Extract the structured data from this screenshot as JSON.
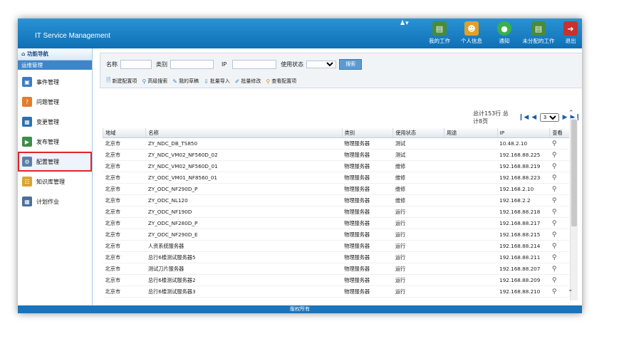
{
  "header": {
    "title": "IT Service Management",
    "nav": [
      {
        "label": "我的工作",
        "icon": "briefcase-icon"
      },
      {
        "label": "个人信息",
        "icon": "user-info-icon"
      },
      {
        "label": "通知",
        "icon": "notification-icon"
      },
      {
        "label": "未分配的工作",
        "icon": "unassigned-icon"
      },
      {
        "label": "退出",
        "icon": "exit-icon"
      }
    ]
  },
  "sidebar": {
    "heading": "功能导航",
    "group": "运维管理",
    "items": [
      {
        "label": "事件管理",
        "icon": "event-icon"
      },
      {
        "label": "问题管理",
        "icon": "problem-icon"
      },
      {
        "label": "变更管理",
        "icon": "change-icon"
      },
      {
        "label": "发布管理",
        "icon": "release-icon"
      },
      {
        "label": "配置管理",
        "icon": "config-icon"
      },
      {
        "label": "知识库管理",
        "icon": "knowledge-icon"
      },
      {
        "label": "计划作业",
        "icon": "calendar-icon"
      }
    ]
  },
  "search": {
    "name_label": "名称",
    "type_label": "类别",
    "ip_label": "IP",
    "status_label": "使用状态",
    "button": "搜索"
  },
  "toolbar": [
    {
      "label": "新建配置项",
      "icon": "new-doc-icon"
    },
    {
      "label": "高级搜索",
      "icon": "advanced-search-icon"
    },
    {
      "label": "我的草稿",
      "icon": "draft-icon"
    },
    {
      "label": "批量导入",
      "icon": "import-icon"
    },
    {
      "label": "批量修改",
      "icon": "batch-edit-icon"
    },
    {
      "label": "查看配置项",
      "icon": "view-config-icon"
    }
  ],
  "pager": {
    "summary": "总计153行 总计8页",
    "current_page": "3"
  },
  "table": {
    "columns": [
      "地域",
      "名称",
      "类别",
      "使用状态",
      "用途",
      "IP",
      "查看"
    ],
    "rows": [
      [
        "北京市",
        "ZY_NDC_DB_TS850",
        "物理服务器",
        "测试",
        "",
        "10.48.2.10"
      ],
      [
        "北京市",
        "ZY_NDC_VM02_NF560D_02",
        "物理服务器",
        "测试",
        "",
        "192.168.88.225"
      ],
      [
        "北京市",
        "ZY_NDC_VM02_NF560D_01",
        "物理服务器",
        "维修",
        "",
        "192.168.88.219"
      ],
      [
        "北京市",
        "ZY_ODC_VM01_NF8560_01",
        "物理服务器",
        "维修",
        "",
        "192.168.88.223"
      ],
      [
        "北京市",
        "ZY_ODC_NF290D_P",
        "物理服务器",
        "维修",
        "",
        "192.168.2.10"
      ],
      [
        "北京市",
        "ZY_ODC_NL120",
        "物理服务器",
        "维修",
        "",
        "192.168.2.2"
      ],
      [
        "北京市",
        "ZY_ODC_NF190D",
        "物理服务器",
        "运行",
        "",
        "192.168.88.218"
      ],
      [
        "北京市",
        "ZY_ODC_NF280D_P",
        "物理服务器",
        "运行",
        "",
        "192.168.88.217"
      ],
      [
        "北京市",
        "ZY_ODC_NF290D_E",
        "物理服务器",
        "运行",
        "",
        "192.168.88.215"
      ],
      [
        "北京市",
        "人资系统服务器",
        "物理服务器",
        "运行",
        "",
        "192.168.88.214"
      ],
      [
        "北京市",
        "总行6楼测试服务器5",
        "物理服务器",
        "运行",
        "",
        "192.168.88.211"
      ],
      [
        "北京市",
        "测试刀片服务器",
        "物理服务器",
        "运行",
        "",
        "192.168.88.207"
      ],
      [
        "北京市",
        "总行6楼测试服务器2",
        "物理服务器",
        "运行",
        "",
        "192.168.88.209"
      ],
      [
        "北京市",
        "总行6楼测试服务器3",
        "物理服务器",
        "运行",
        "",
        "192.168.88.210"
      ]
    ]
  },
  "footer": "版权所有"
}
